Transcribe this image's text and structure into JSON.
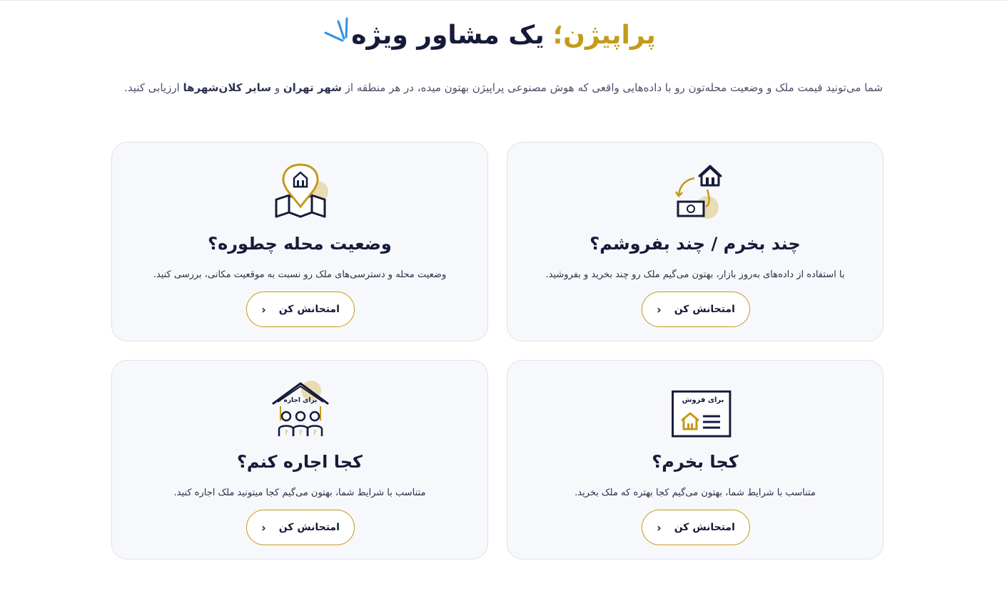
{
  "header": {
    "brand": "پراپیژن؛",
    "title_rest": "یک مشاور ویژه",
    "subtitle_part1": "شما می‌تونید قیمت ملک و وضعیت محله‌تون رو با داده‌هایی واقعی که هوش مصنوعی پراپیژن بهتون میده، در هر منطقه از",
    "subtitle_bold1": "شهر تهران",
    "subtitle_and": "و",
    "subtitle_bold2": "سایر کلان‌شهرها",
    "subtitle_end": "ارزیابی کنید."
  },
  "cards": [
    {
      "title": "چند بخرم / چند بفروشم؟",
      "description": "با استفاده از داده‌های به‌روز بازار، بهتون می‌گیم ملک رو چند بخرید و بفروشید.",
      "button": "امتحانش کن",
      "icon": "house-money-exchange-icon"
    },
    {
      "title": "وضعیت محله چطوره؟",
      "description": "وضعیت محله و دسترسی‌های ملک رو نسبت به موقعیت مکانی، بررسی کنید.",
      "button": "امتحانش کن",
      "icon": "map-pin-house-icon"
    },
    {
      "title": "کجا بخرم؟",
      "description": "متناسب با شرایط شما، بهتون می‌گیم کجا بهتره که ملک بخرید.",
      "button": "امتحانش کن",
      "icon": "for-sale-sign-icon",
      "icon_text": "برای فروش"
    },
    {
      "title": "کجا اجاره کنم؟",
      "description": "متناسب با شرایط شما، بهتون می‌گیم کجا میتونید ملک اجاره کنید.",
      "button": "امتحانش کن",
      "icon": "for-rent-house-people-icon",
      "icon_text": "برای اجاره"
    }
  ],
  "colors": {
    "accent": "#c49a1a",
    "navy": "#151b3a",
    "card_bg": "#f7f8fb",
    "sparkle": "#2f8fe8"
  }
}
